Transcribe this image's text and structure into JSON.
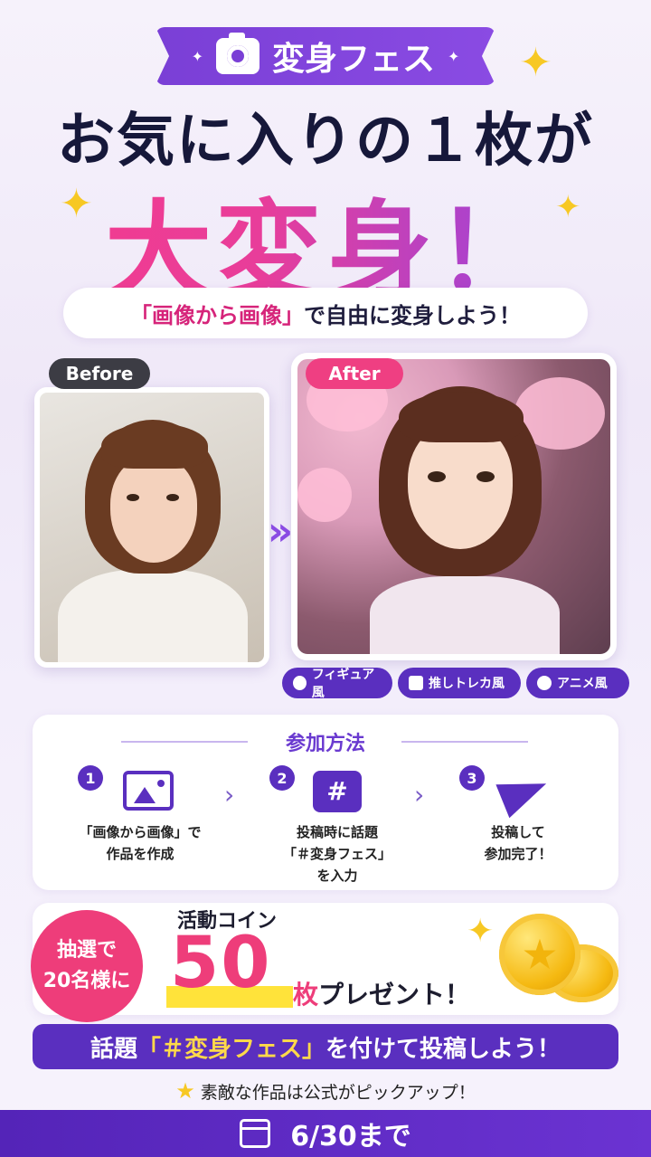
{
  "header": {
    "badge_label": "変身フェス",
    "headline": "お気に入りの１枚が",
    "big_text": "大変身！",
    "subtitle_quote": "「画像から画像」",
    "subtitle_rest": "で自由に変身しよう！"
  },
  "photos": {
    "before_label": "Before",
    "after_label": "After"
  },
  "styles": [
    {
      "label": "フィギュア風",
      "icon": "figure-icon"
    },
    {
      "label": "推しトレカ風",
      "icon": "card-icon"
    },
    {
      "label": "アニメ風",
      "icon": "palette-icon"
    }
  ],
  "steps": {
    "title": "参加方法",
    "items": [
      {
        "num": "1",
        "icon": "image-icon",
        "text": "「画像から画像」で\n作品を作成"
      },
      {
        "num": "2",
        "icon": "hashtag-icon",
        "text": "投稿時に話題\n「＃変身フェス」\nを入力"
      },
      {
        "num": "3",
        "icon": "paper-plane-icon",
        "text": "投稿して\n参加完了！"
      }
    ]
  },
  "prize": {
    "lottery_line1": "抽選で",
    "lottery_line2": "20名様に",
    "coin_label": "活動コイン",
    "amount": "50",
    "unit": "枚",
    "present": "プレゼント！"
  },
  "cta": {
    "prefix": "話題",
    "hashtag": "「＃変身フェス」",
    "suffix": "を付けて投稿しよう！"
  },
  "pickup": "素敵な作品は公式がピックアップ！",
  "deadline": "6/30まで",
  "colors": {
    "purple": "#5a2fbf",
    "pink": "#ee3d7a",
    "yellow": "#ffd94a"
  }
}
